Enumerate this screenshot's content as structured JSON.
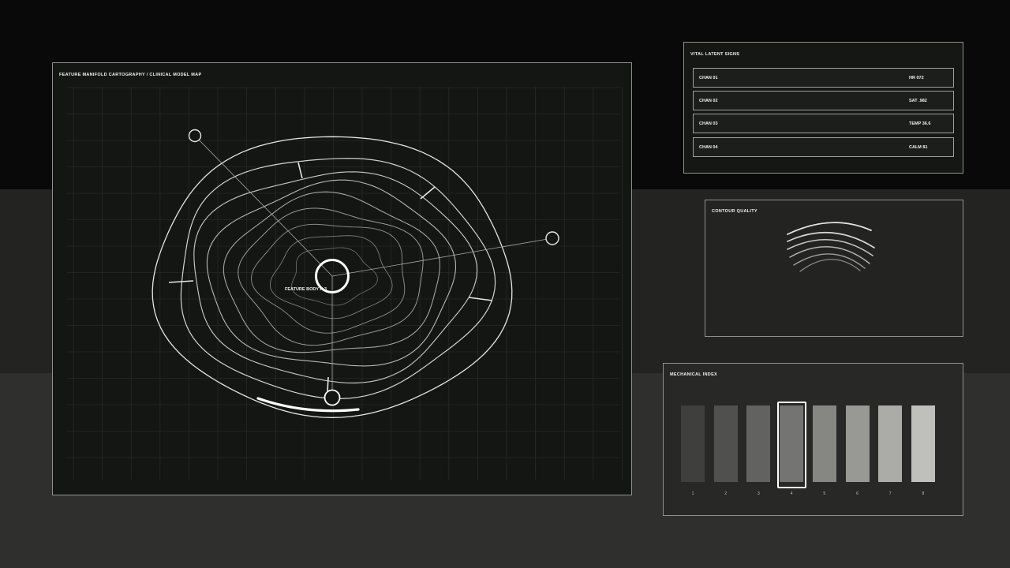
{
  "map": {
    "title": "FEATURE MANIFOLD CARTOGRAPHY / CLINICAL MODEL MAP",
    "body_label": "FEATURE BODY A-3"
  },
  "vitals": {
    "title": "VITAL LATENT SIGNS",
    "rows": [
      {
        "channel": "CHAN 01",
        "value": "HR 072"
      },
      {
        "channel": "CHAN 02",
        "value": "SAT .982"
      },
      {
        "channel": "CHAN 03",
        "value": "TEMP 36.6"
      },
      {
        "channel": "CHAN 04",
        "value": "CALM 81"
      }
    ]
  },
  "contour": {
    "title": "CONTOUR QUALITY"
  },
  "mechanical": {
    "title": "MECHANICAL INDEX",
    "selected_index": 4,
    "bars": [
      {
        "label": "1",
        "color": "#3f403e"
      },
      {
        "label": "2",
        "color": "#50514f"
      },
      {
        "label": "3",
        "color": "#626360"
      },
      {
        "label": "4",
        "color": "#747572"
      },
      {
        "label": "5",
        "color": "#868783"
      },
      {
        "label": "6",
        "color": "#989995"
      },
      {
        "label": "7",
        "color": "#abaca8"
      },
      {
        "label": "8",
        "color": "#bfc0bc"
      }
    ]
  },
  "colors": {
    "background_top": "#080908",
    "background_mid": "#232422",
    "background_bottom": "#2f302e",
    "line": "#e8e8e6",
    "panel_border": "#8e918b"
  }
}
